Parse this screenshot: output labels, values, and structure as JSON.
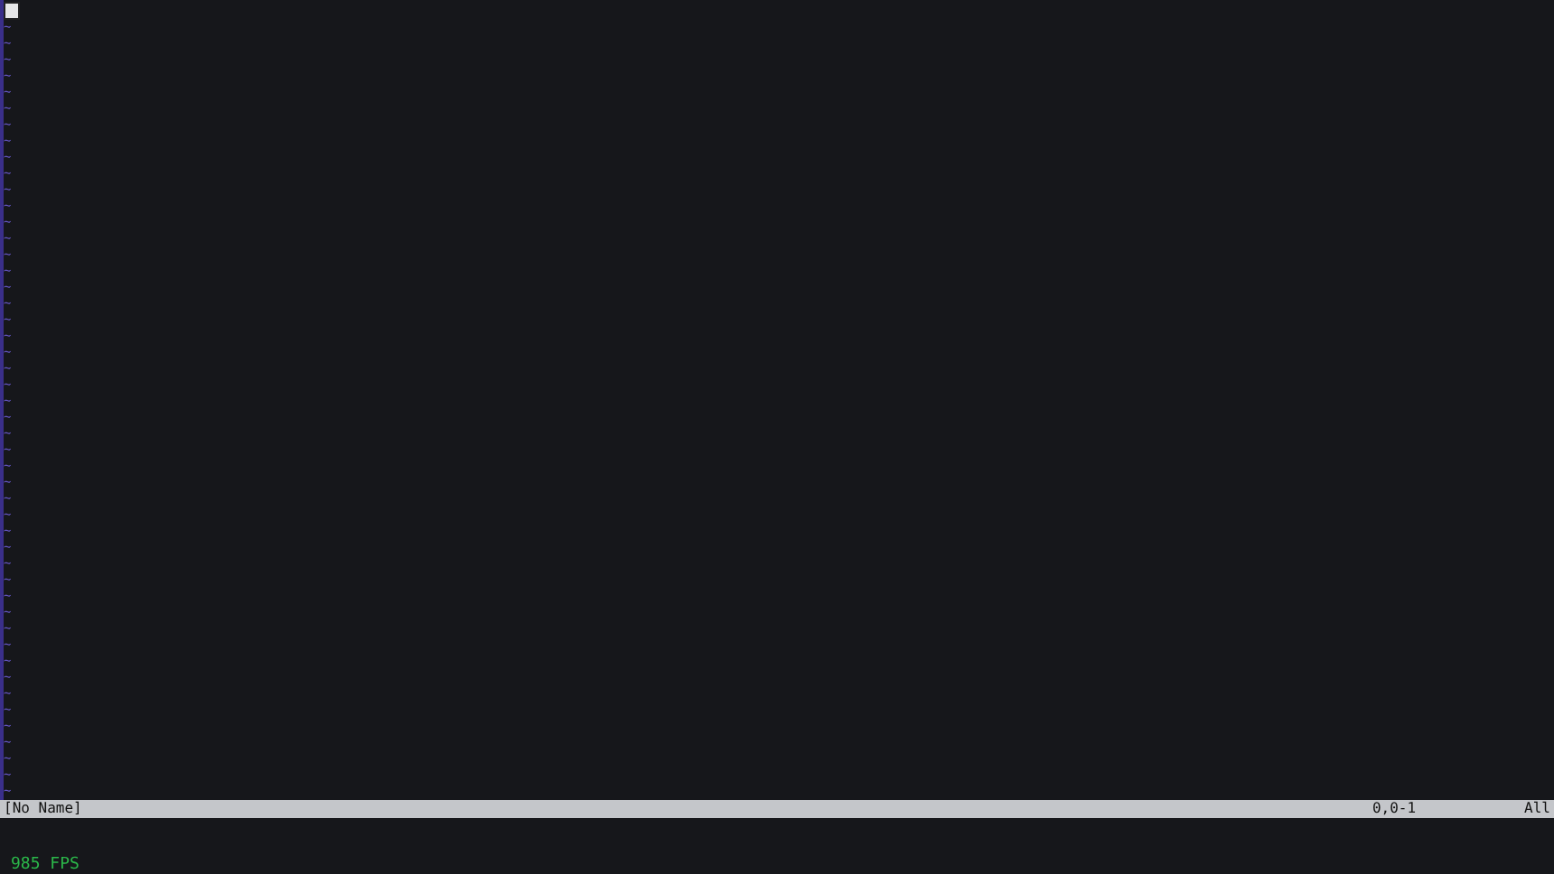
{
  "editor": {
    "cursor_visible": true,
    "empty_lines": [
      "~",
      "~",
      "~",
      "~",
      "~",
      "~",
      "~",
      "~",
      "~",
      "~",
      "~",
      "~",
      "~",
      "~",
      "~",
      "~",
      "~",
      "~",
      "~",
      "~",
      "~",
      "~",
      "~",
      "~",
      "~",
      "~",
      "~",
      "~",
      "~",
      "~",
      "~",
      "~",
      "~",
      "~",
      "~",
      "~",
      "~",
      "~",
      "~",
      "~",
      "~",
      "~",
      "~",
      "~",
      "~",
      "~",
      "~",
      "~"
    ]
  },
  "status_line": {
    "file": "[No Name]",
    "position": "0,0-1",
    "scroll": "All"
  },
  "fps_counter": "985 FPS"
}
